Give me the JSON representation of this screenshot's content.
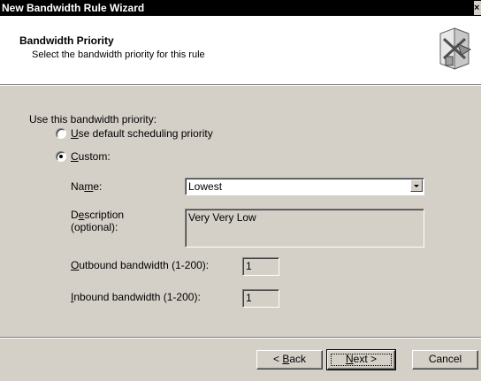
{
  "window": {
    "title": "New Bandwidth Rule Wizard",
    "close_glyph": "×"
  },
  "header": {
    "title": "Bandwidth Priority",
    "subtitle": "Select the bandwidth priority for this rule",
    "icon": "wizard-graphic-icon"
  },
  "body": {
    "prompt": "Use this bandwidth priority:",
    "options": [
      {
        "label_key": "U",
        "label_rest": "se default scheduling priority",
        "selected": false
      },
      {
        "label_key": "C",
        "label_rest": "ustom:",
        "selected": true
      }
    ],
    "name": {
      "label_pre": "Na",
      "label_key": "m",
      "label_post": "e:",
      "value": "Lowest"
    },
    "description": {
      "label_pre": "D",
      "label_key": "e",
      "label_post": "scription",
      "label_line2": "(optional):",
      "value": "Very Very Low"
    },
    "outbound": {
      "label_key": "O",
      "label_rest": "utbound bandwidth (1-200):",
      "value": "1"
    },
    "inbound": {
      "label_key": "I",
      "label_rest": "nbound bandwidth (1-200):",
      "value": "1"
    }
  },
  "buttons": {
    "back": {
      "prefix": "< ",
      "key": "B",
      "rest": "ack"
    },
    "next": {
      "key": "N",
      "rest": "ext >"
    },
    "cancel": "Cancel"
  }
}
